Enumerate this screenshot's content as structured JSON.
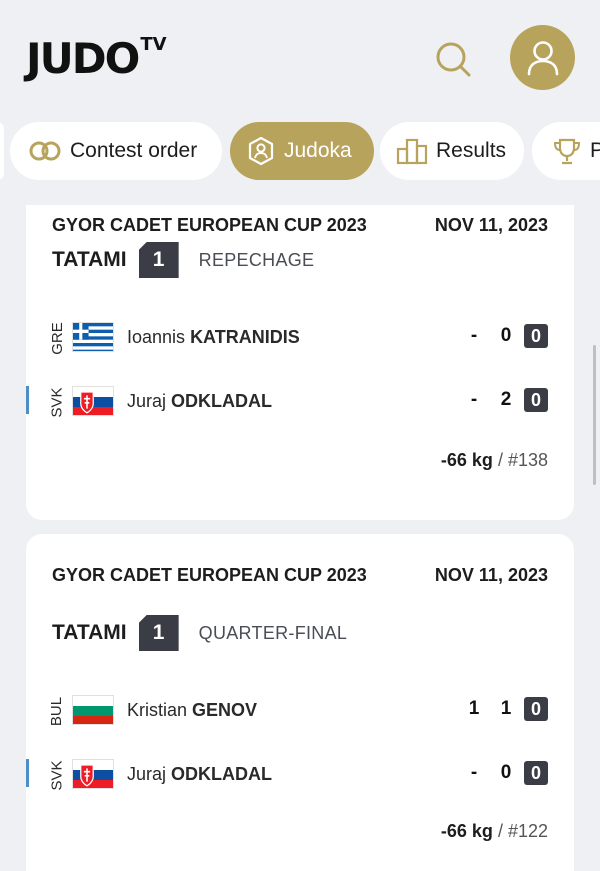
{
  "header": {
    "logo_text": "JUDO",
    "logo_sup": "TV"
  },
  "tabs": [
    {
      "label": "Contest order",
      "icon": "rings-icon",
      "active": false
    },
    {
      "label": "Judoka",
      "icon": "judoka-icon",
      "active": true
    },
    {
      "label": "Results",
      "icon": "podium-icon",
      "active": false
    },
    {
      "label": "P",
      "icon": "trophy-icon",
      "active": false
    }
  ],
  "colors": {
    "accent": "#b8a35c",
    "dark": "#3a3d46",
    "background": "#eef0f4",
    "active_marker": "#4b8fc9"
  },
  "contests": [
    {
      "event": "GYOR CADET EUROPEAN CUP 2023",
      "date": "NOV 11, 2023",
      "tatami_label": "TATAMI",
      "tatami": "1",
      "round": "REPECHAGE",
      "competitors": [
        {
          "country": "GRE",
          "first": "Ioannis",
          "last": "KATRANIDIS",
          "score1": "-",
          "score2": "0",
          "shido": "0",
          "active": false
        },
        {
          "country": "SVK",
          "first": "Juraj",
          "last": "ODKLADAL",
          "score1": "-",
          "score2": "2",
          "shido": "0",
          "active": true
        }
      ],
      "weight": "-66 kg",
      "contest_no": "/ #138"
    },
    {
      "event": "GYOR CADET EUROPEAN CUP 2023",
      "date": "NOV 11, 2023",
      "tatami_label": "TATAMI",
      "tatami": "1",
      "round": "QUARTER-FINAL",
      "competitors": [
        {
          "country": "BUL",
          "first": "Kristian",
          "last": "GENOV",
          "score1": "1",
          "score2": "1",
          "shido": "0",
          "active": false
        },
        {
          "country": "SVK",
          "first": "Juraj",
          "last": "ODKLADAL",
          "score1": "-",
          "score2": "0",
          "shido": "0",
          "active": true
        }
      ],
      "weight": "-66 kg",
      "contest_no": "/ #122"
    }
  ]
}
